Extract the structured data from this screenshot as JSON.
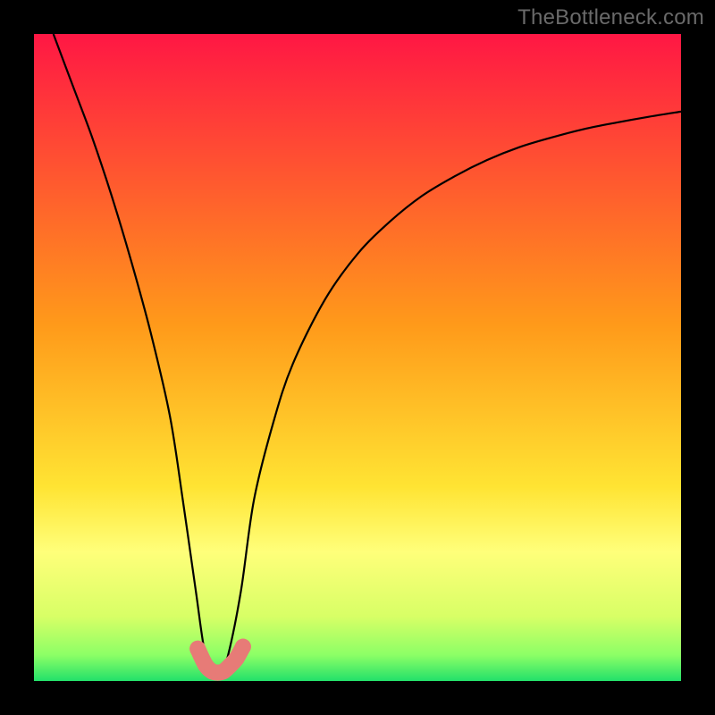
{
  "watermark": "TheBottleneck.com",
  "chart_data": {
    "type": "line",
    "title": "",
    "xlabel": "",
    "ylabel": "",
    "xlim": [
      0,
      100
    ],
    "ylim": [
      0,
      100
    ],
    "grid": false,
    "legend": false,
    "gradient_stops": [
      {
        "offset": 0,
        "color": "#ff1744"
      },
      {
        "offset": 45,
        "color": "#ff9a1a"
      },
      {
        "offset": 70,
        "color": "#ffe433"
      },
      {
        "offset": 80,
        "color": "#ffff7a"
      },
      {
        "offset": 90,
        "color": "#d8ff66"
      },
      {
        "offset": 96,
        "color": "#8cff66"
      },
      {
        "offset": 100,
        "color": "#22e06a"
      }
    ],
    "series": [
      {
        "name": "bottleneck-curve",
        "lineonly": true,
        "x": [
          3,
          6,
          9,
          12,
          15,
          18,
          21,
          23,
          25,
          26.5,
          28,
          29,
          30,
          32,
          34,
          37,
          40,
          45,
          50,
          55,
          60,
          65,
          70,
          75,
          80,
          85,
          90,
          95,
          100
        ],
        "y": [
          100,
          92,
          84,
          75,
          65,
          54,
          41,
          28,
          14,
          4,
          2,
          2,
          4,
          14,
          28,
          40,
          49,
          59,
          66,
          71,
          75,
          78,
          80.5,
          82.5,
          84,
          85.3,
          86.3,
          87.2,
          88
        ]
      },
      {
        "name": "highlight-points",
        "type": "scatter",
        "x": [
          25.3,
          26.5,
          27.5,
          28.4,
          29.3,
          30.3,
          31.3,
          32.3
        ],
        "y": [
          5.0,
          2.5,
          1.5,
          1.3,
          1.5,
          2.4,
          3.5,
          5.3
        ],
        "color": "#e77b77",
        "size": 9
      }
    ]
  }
}
